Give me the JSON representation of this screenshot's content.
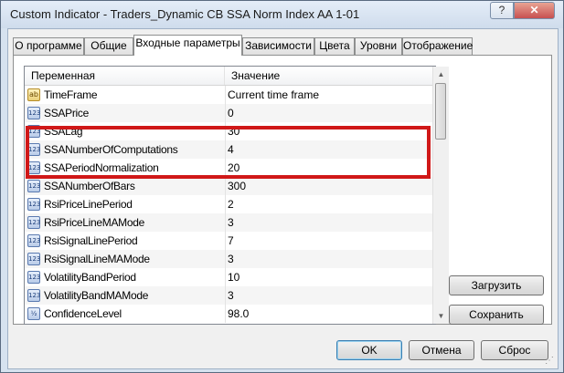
{
  "window": {
    "title": "Custom Indicator - Traders_Dynamic CB SSA Norm Index AA 1-01",
    "help_label": "?",
    "close_label": "✕"
  },
  "tabs": [
    {
      "label": "О программе"
    },
    {
      "label": "Общие"
    },
    {
      "label": "Входные параметры",
      "active": true
    },
    {
      "label": "Зависимости"
    },
    {
      "label": "Цвета"
    },
    {
      "label": "Уровни"
    },
    {
      "label": "Отображение"
    }
  ],
  "grid": {
    "headers": {
      "name": "Переменная",
      "value": "Значение"
    },
    "rows": [
      {
        "icon": "ab",
        "name": "TimeFrame",
        "value": "Current time frame"
      },
      {
        "icon": "123",
        "name": "SSAPrice",
        "value": "0"
      },
      {
        "icon": "123",
        "name": "SSALag",
        "value": "30"
      },
      {
        "icon": "123",
        "name": "SSANumberOfComputations",
        "value": "4"
      },
      {
        "icon": "123",
        "name": "SSAPeriodNormalization",
        "value": "20"
      },
      {
        "icon": "123",
        "name": "SSANumberOfBars",
        "value": "300"
      },
      {
        "icon": "123",
        "name": "RsiPriceLinePeriod",
        "value": "2"
      },
      {
        "icon": "123",
        "name": "RsiPriceLineMAMode",
        "value": "3"
      },
      {
        "icon": "123",
        "name": "RsiSignalLinePeriod",
        "value": "7"
      },
      {
        "icon": "123",
        "name": "RsiSignalLineMAMode",
        "value": "3"
      },
      {
        "icon": "123",
        "name": "VolatilityBandPeriod",
        "value": "10"
      },
      {
        "icon": "123",
        "name": "VolatilityBandMAMode",
        "value": "3"
      },
      {
        "icon": "½",
        "name": "ConfidenceLevel",
        "value": "98.0"
      }
    ]
  },
  "buttons": {
    "load": "Загрузить",
    "save": "Сохранить",
    "ok": "OK",
    "cancel": "Отмена",
    "reset": "Сброс"
  },
  "highlight_color": "#d01818"
}
